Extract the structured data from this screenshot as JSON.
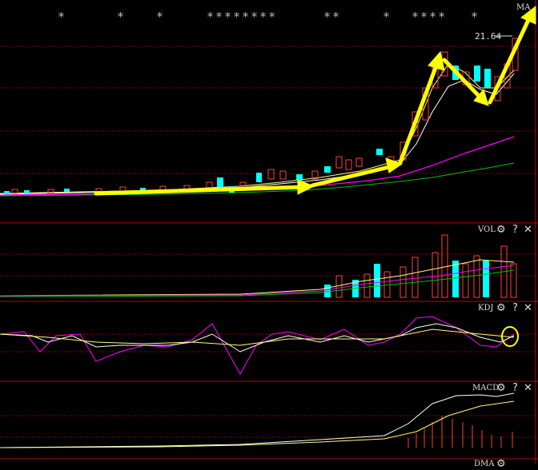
{
  "top_stars": [
    {
      "text": "*"
    },
    {
      "text": "*"
    },
    {
      "text": "*"
    },
    {
      "text": "********"
    },
    {
      "text": "**"
    },
    {
      "text": "*"
    },
    {
      "text": "****"
    },
    {
      "text": "*"
    }
  ],
  "main": {
    "indicator": "MA",
    "price_label": "21.64"
  },
  "vol": {
    "name": "VOL"
  },
  "kdj": {
    "name": "KDJ"
  },
  "macd": {
    "name": "MACD"
  },
  "bottom": {
    "name": "DMA"
  },
  "controls": {
    "settings": "⚙",
    "help": "?",
    "close": "✕"
  },
  "colors": {
    "background": "#000000",
    "grid": "#8b0000",
    "up": "#ff4040",
    "down": "#00ffff",
    "arrow": "#ffff00",
    "ma_magenta": "#ff00ff",
    "ma_green": "#00c000"
  }
}
